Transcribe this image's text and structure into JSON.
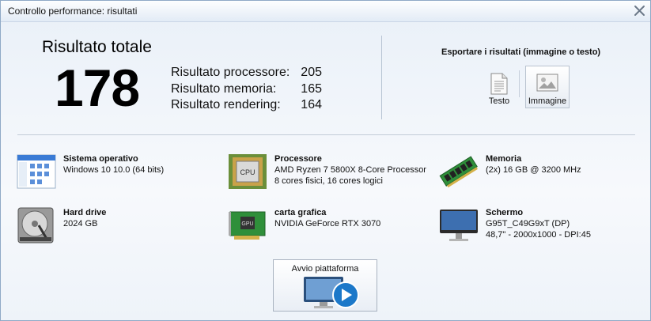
{
  "window": {
    "title": "Controllo performance: risultati"
  },
  "score": {
    "title": "Risultato totale",
    "total": "178",
    "breakdown": [
      {
        "label": "Risultato processore:",
        "value": "205"
      },
      {
        "label": "Risultato memoria:",
        "value": "165"
      },
      {
        "label": "Risultato rendering:",
        "value": "164"
      }
    ]
  },
  "export": {
    "title": "Esportare i risultati (immagine o testo)",
    "text_label": "Testo",
    "image_label": "Immagine"
  },
  "system": {
    "os": {
      "label": "Sistema operativo",
      "line1": "Windows 10 10.0 (64 bits)"
    },
    "cpu": {
      "label": "Processore",
      "line1": "AMD Ryzen 7 5800X 8-Core Processor",
      "line2": "8 cores fisici, 16 cores logici",
      "chip_text": "CPU"
    },
    "memory": {
      "label": "Memoria",
      "line1": "(2x) 16 GB @ 3200 MHz"
    },
    "disk": {
      "label": "Hard drive",
      "line1": "2024 GB"
    },
    "gpu": {
      "label": "carta grafica",
      "line1": "NVIDIA GeForce RTX 3070",
      "chip_text": "GPU"
    },
    "screen": {
      "label": "Schermo",
      "line1": "G95T_C49G9xT (DP)",
      "line2": "48,7\" - 2000x1000 - DPI:45"
    }
  },
  "launch": {
    "label": "Avvio piattaforma"
  }
}
